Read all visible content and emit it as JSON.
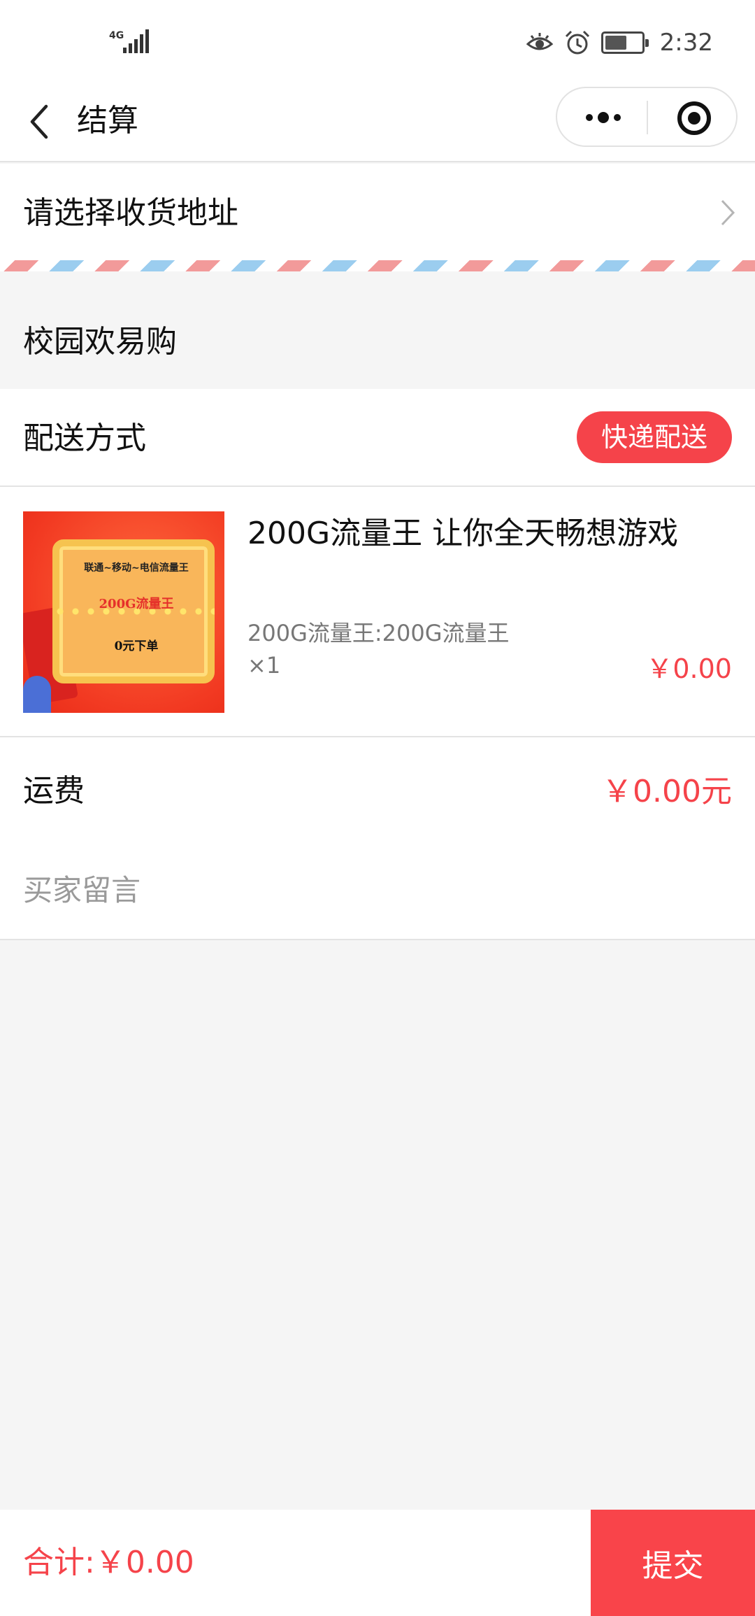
{
  "status_bar": {
    "network": "4G",
    "time": "2:32",
    "icons": [
      "signal-icon",
      "eye-icon",
      "alarm-icon",
      "battery-icon"
    ],
    "battery_level": 0.6
  },
  "nav": {
    "title": "结算",
    "icons": [
      "back-icon",
      "more-icon",
      "target-icon"
    ]
  },
  "address": {
    "placeholder_text": "请选择收货地址"
  },
  "shop": {
    "name": "校园欢易购"
  },
  "delivery": {
    "label": "配送方式",
    "method": "快递配送"
  },
  "product": {
    "title": "200G流量王 让你全天畅想游戏",
    "spec": "200G流量王:200G流量王",
    "quantity": "×1",
    "price": "￥0.00",
    "image_text": [
      "联通~移动~电信流量王",
      "200G流量王",
      "0元下单"
    ]
  },
  "freight": {
    "label": "运费",
    "value": "￥0.00元"
  },
  "message": {
    "placeholder": "买家留言"
  },
  "footer": {
    "total": "合计:￥0.00",
    "submit_label": "提交"
  },
  "colors": {
    "accent": "#f5434a",
    "background": "#f5f5f5",
    "airmail_red": "#f29a9a",
    "airmail_blue": "#9bcdef"
  }
}
